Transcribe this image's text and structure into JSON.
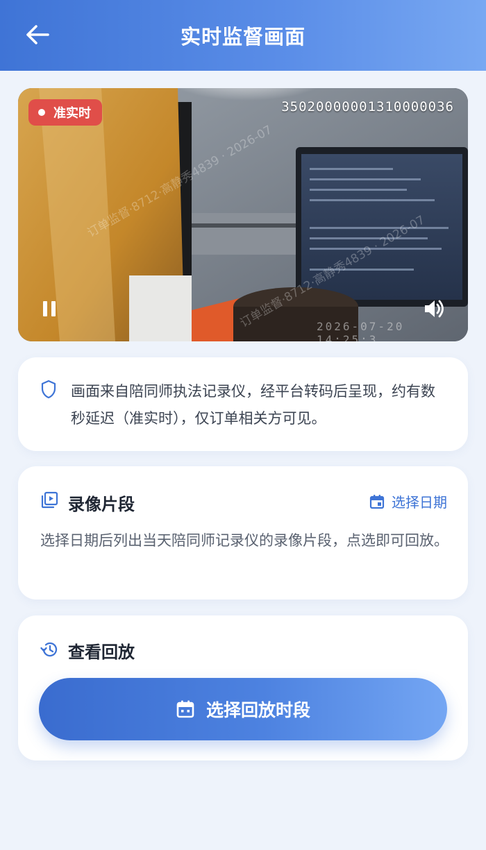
{
  "header": {
    "title": "实时监督画面",
    "back_icon": "arrow-left-icon"
  },
  "video": {
    "badge": "准实时",
    "device_id": "35020000001310000036",
    "watermark": "订单监督·8712·高静秀4839 · 2026-07",
    "timestamp": "2026-07-20 14:25:3",
    "controls": {
      "pause_icon": "pause-icon",
      "volume_icon": "volume-icon"
    },
    "colors": {
      "badge": "#e04e49"
    }
  },
  "notice": {
    "icon": "shield-icon",
    "text": "画面来自陪同师执法记录仪，经平台转码后呈现，约有数秒延迟（准实时），仅订单相关方可见。"
  },
  "recordings": {
    "icon": "video-library-icon",
    "title": "录像片段",
    "pick_date_label": "选择日期",
    "pick_date_icon": "calendar-icon",
    "description": "选择日期后列出当天陪同师记录仪的录像片段，点选即可回放。"
  },
  "playback": {
    "icon": "history-icon",
    "title": "查看回放",
    "button_label": "选择回放时段",
    "button_icon": "calendar-icon"
  },
  "theme": {
    "primary": "#3e74d6",
    "background": "#eef3fb"
  }
}
